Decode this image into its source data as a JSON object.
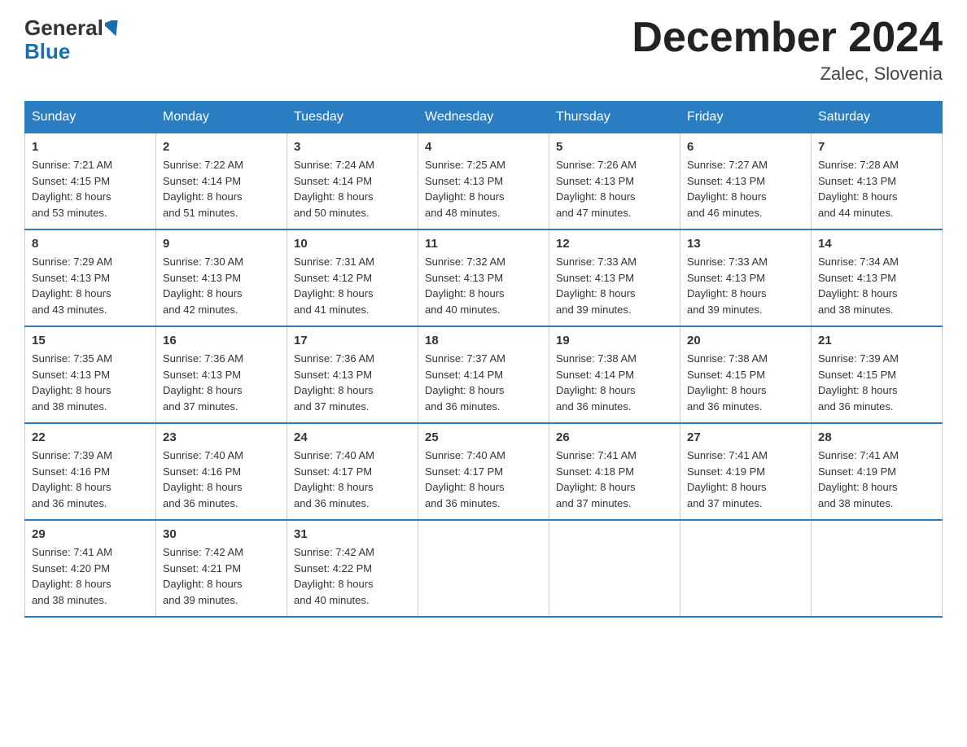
{
  "header": {
    "logo_general": "General",
    "logo_blue": "Blue",
    "title": "December 2024",
    "location": "Zalec, Slovenia"
  },
  "weekdays": [
    "Sunday",
    "Monday",
    "Tuesday",
    "Wednesday",
    "Thursday",
    "Friday",
    "Saturday"
  ],
  "weeks": [
    [
      {
        "day": "1",
        "sunrise": "7:21 AM",
        "sunset": "4:15 PM",
        "daylight": "8 hours and 53 minutes."
      },
      {
        "day": "2",
        "sunrise": "7:22 AM",
        "sunset": "4:14 PM",
        "daylight": "8 hours and 51 minutes."
      },
      {
        "day": "3",
        "sunrise": "7:24 AM",
        "sunset": "4:14 PM",
        "daylight": "8 hours and 50 minutes."
      },
      {
        "day": "4",
        "sunrise": "7:25 AM",
        "sunset": "4:13 PM",
        "daylight": "8 hours and 48 minutes."
      },
      {
        "day": "5",
        "sunrise": "7:26 AM",
        "sunset": "4:13 PM",
        "daylight": "8 hours and 47 minutes."
      },
      {
        "day": "6",
        "sunrise": "7:27 AM",
        "sunset": "4:13 PM",
        "daylight": "8 hours and 46 minutes."
      },
      {
        "day": "7",
        "sunrise": "7:28 AM",
        "sunset": "4:13 PM",
        "daylight": "8 hours and 44 minutes."
      }
    ],
    [
      {
        "day": "8",
        "sunrise": "7:29 AM",
        "sunset": "4:13 PM",
        "daylight": "8 hours and 43 minutes."
      },
      {
        "day": "9",
        "sunrise": "7:30 AM",
        "sunset": "4:13 PM",
        "daylight": "8 hours and 42 minutes."
      },
      {
        "day": "10",
        "sunrise": "7:31 AM",
        "sunset": "4:12 PM",
        "daylight": "8 hours and 41 minutes."
      },
      {
        "day": "11",
        "sunrise": "7:32 AM",
        "sunset": "4:13 PM",
        "daylight": "8 hours and 40 minutes."
      },
      {
        "day": "12",
        "sunrise": "7:33 AM",
        "sunset": "4:13 PM",
        "daylight": "8 hours and 39 minutes."
      },
      {
        "day": "13",
        "sunrise": "7:33 AM",
        "sunset": "4:13 PM",
        "daylight": "8 hours and 39 minutes."
      },
      {
        "day": "14",
        "sunrise": "7:34 AM",
        "sunset": "4:13 PM",
        "daylight": "8 hours and 38 minutes."
      }
    ],
    [
      {
        "day": "15",
        "sunrise": "7:35 AM",
        "sunset": "4:13 PM",
        "daylight": "8 hours and 38 minutes."
      },
      {
        "day": "16",
        "sunrise": "7:36 AM",
        "sunset": "4:13 PM",
        "daylight": "8 hours and 37 minutes."
      },
      {
        "day": "17",
        "sunrise": "7:36 AM",
        "sunset": "4:13 PM",
        "daylight": "8 hours and 37 minutes."
      },
      {
        "day": "18",
        "sunrise": "7:37 AM",
        "sunset": "4:14 PM",
        "daylight": "8 hours and 36 minutes."
      },
      {
        "day": "19",
        "sunrise": "7:38 AM",
        "sunset": "4:14 PM",
        "daylight": "8 hours and 36 minutes."
      },
      {
        "day": "20",
        "sunrise": "7:38 AM",
        "sunset": "4:15 PM",
        "daylight": "8 hours and 36 minutes."
      },
      {
        "day": "21",
        "sunrise": "7:39 AM",
        "sunset": "4:15 PM",
        "daylight": "8 hours and 36 minutes."
      }
    ],
    [
      {
        "day": "22",
        "sunrise": "7:39 AM",
        "sunset": "4:16 PM",
        "daylight": "8 hours and 36 minutes."
      },
      {
        "day": "23",
        "sunrise": "7:40 AM",
        "sunset": "4:16 PM",
        "daylight": "8 hours and 36 minutes."
      },
      {
        "day": "24",
        "sunrise": "7:40 AM",
        "sunset": "4:17 PM",
        "daylight": "8 hours and 36 minutes."
      },
      {
        "day": "25",
        "sunrise": "7:40 AM",
        "sunset": "4:17 PM",
        "daylight": "8 hours and 36 minutes."
      },
      {
        "day": "26",
        "sunrise": "7:41 AM",
        "sunset": "4:18 PM",
        "daylight": "8 hours and 37 minutes."
      },
      {
        "day": "27",
        "sunrise": "7:41 AM",
        "sunset": "4:19 PM",
        "daylight": "8 hours and 37 minutes."
      },
      {
        "day": "28",
        "sunrise": "7:41 AM",
        "sunset": "4:19 PM",
        "daylight": "8 hours and 38 minutes."
      }
    ],
    [
      {
        "day": "29",
        "sunrise": "7:41 AM",
        "sunset": "4:20 PM",
        "daylight": "8 hours and 38 minutes."
      },
      {
        "day": "30",
        "sunrise": "7:42 AM",
        "sunset": "4:21 PM",
        "daylight": "8 hours and 39 minutes."
      },
      {
        "day": "31",
        "sunrise": "7:42 AM",
        "sunset": "4:22 PM",
        "daylight": "8 hours and 40 minutes."
      },
      null,
      null,
      null,
      null
    ]
  ],
  "labels": {
    "sunrise": "Sunrise:",
    "sunset": "Sunset:",
    "daylight": "Daylight:"
  }
}
